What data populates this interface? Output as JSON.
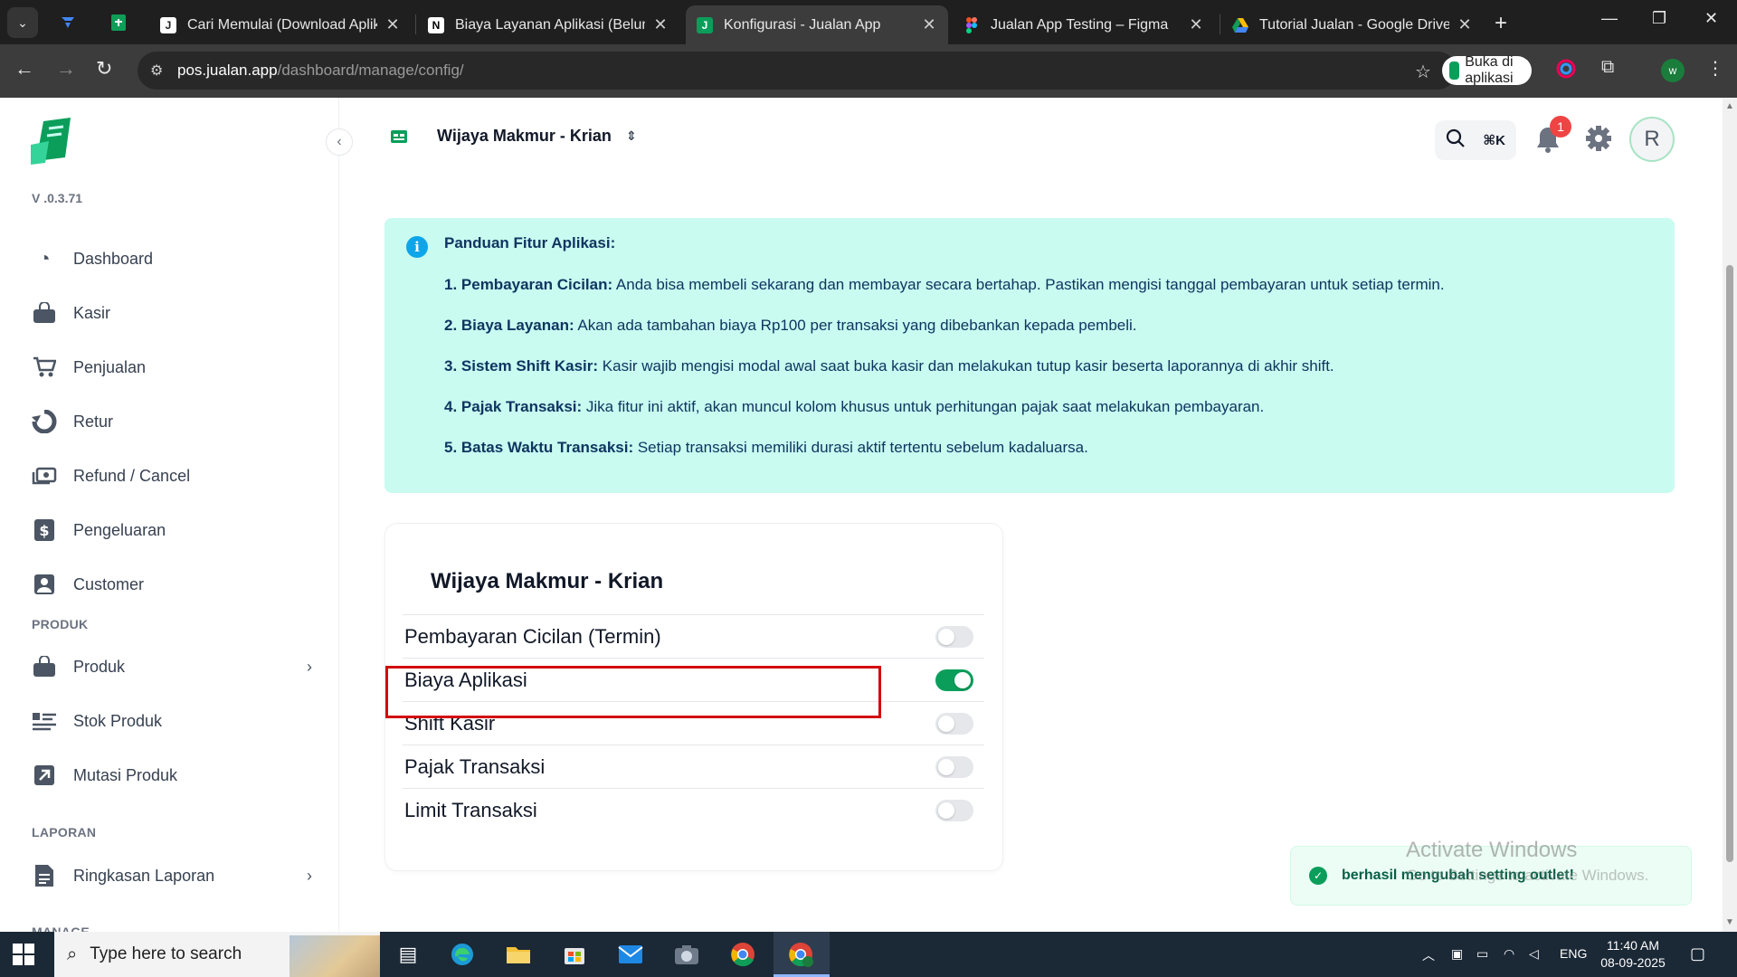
{
  "browser": {
    "tabs": [
      {
        "title": "Cari Memulai (Download Aplika"
      },
      {
        "title": "Biaya Layanan Aplikasi (Belum)"
      },
      {
        "title": "Konfigurasi - Jualan App"
      },
      {
        "title": "Jualan App Testing – Figma"
      },
      {
        "title": "Tutorial Jualan - Google Drive"
      }
    ],
    "url_host": "pos.jualan.app",
    "url_path": "/dashboard/manage/config/",
    "open_in_app": "Buka di aplikasi"
  },
  "sidebar": {
    "version": "V .0.3.71",
    "items": [
      {
        "label": "Dashboard",
        "icon": "gauge-icon"
      },
      {
        "label": "Kasir",
        "icon": "bag-icon"
      },
      {
        "label": "Penjualan",
        "icon": "cart-icon"
      },
      {
        "label": "Retur",
        "icon": "return-icon"
      },
      {
        "label": "Refund / Cancel",
        "icon": "refund-icon"
      },
      {
        "label": "Pengeluaran",
        "icon": "dollar-icon"
      },
      {
        "label": "Customer",
        "icon": "user-icon"
      }
    ],
    "section_produk": "PRODUK",
    "produk_items": [
      {
        "label": "Produk"
      },
      {
        "label": "Stok Produk"
      },
      {
        "label": "Mutasi Produk"
      }
    ],
    "section_laporan": "LAPORAN",
    "laporan_items": [
      {
        "label": "Ringkasan Laporan"
      }
    ],
    "section_manage": "MANAGE"
  },
  "header": {
    "outlet": "Wijaya Makmur - Krian",
    "search_shortcut": "⌘K",
    "notif_count": "1",
    "avatar_initial": "R"
  },
  "info": {
    "title": "Panduan Fitur Aplikasi:",
    "lines": [
      {
        "bold": "1. Pembayaran Cicilan:",
        "text": " Anda bisa membeli sekarang dan membayar secara bertahap. Pastikan mengisi tanggal pembayaran untuk setiap termin."
      },
      {
        "bold": "2. Biaya Layanan:",
        "text": " Akan ada tambahan biaya Rp100 per transaksi yang dibebankan kepada pembeli."
      },
      {
        "bold": "3. Sistem Shift Kasir:",
        "text": " Kasir wajib mengisi modal awal saat buka kasir dan melakukan tutup kasir beserta laporannya di akhir shift."
      },
      {
        "bold": "4. Pajak Transaksi:",
        "text": " Jika fitur ini aktif, akan muncul kolom khusus untuk perhitungan pajak saat melakukan pembayaran."
      },
      {
        "bold": "5. Batas Waktu Transaksi:",
        "text": " Setiap transaksi memiliki durasi aktif tertentu sebelum kadaluarsa."
      }
    ]
  },
  "config": {
    "title": "Wijaya Makmur - Krian",
    "settings": [
      {
        "label": "Pembayaran Cicilan (Termin)",
        "enabled": false
      },
      {
        "label": "Biaya Aplikasi",
        "enabled": true
      },
      {
        "label": "Shift Kasir",
        "enabled": false
      },
      {
        "label": "Pajak Transaksi",
        "enabled": false
      },
      {
        "label": "Limit Transaksi",
        "enabled": false
      }
    ]
  },
  "toast": {
    "message": "berhasil mengubah setting outlet!"
  },
  "watermark": {
    "title": "Activate Windows",
    "subtitle": "Go to Settings to activate Windows."
  },
  "taskbar": {
    "search_placeholder": "Type here to search",
    "language": "ENG",
    "time": "11:40 AM",
    "date": "08-09-2025"
  },
  "colors": {
    "brand_green": "#0b9e5b",
    "info_bg": "#c9fbf0",
    "highlight_red": "#d40b0b"
  }
}
